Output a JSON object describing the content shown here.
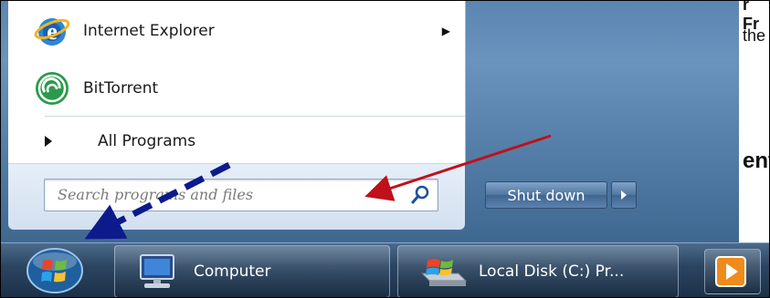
{
  "start_menu": {
    "programs": [
      {
        "label": "Internet Explorer",
        "icon": "internet-explorer-icon",
        "has_submenu": true
      },
      {
        "label": "BitTorrent",
        "icon": "bittorrent-icon",
        "has_submenu": false
      }
    ],
    "all_programs_label": "All Programs",
    "search": {
      "placeholder": "Search programs and files",
      "icon": "search-icon"
    },
    "shutdown_label": "Shut down"
  },
  "taskbar": {
    "start_icon": "windows-start-orb-icon",
    "buttons": [
      {
        "label": "Computer",
        "icon": "computer-icon"
      },
      {
        "label": "Local Disk (C:) Pr...",
        "icon": "local-disk-icon"
      }
    ],
    "tray_icon": "media-player-icon"
  },
  "background_doc": {
    "line1": "r Fr",
    "line2": "the",
    "line3": "ent"
  },
  "annotations": {
    "red_arrow_color": "#c0101a",
    "blue_arrow_color": "#0d1a8c"
  }
}
